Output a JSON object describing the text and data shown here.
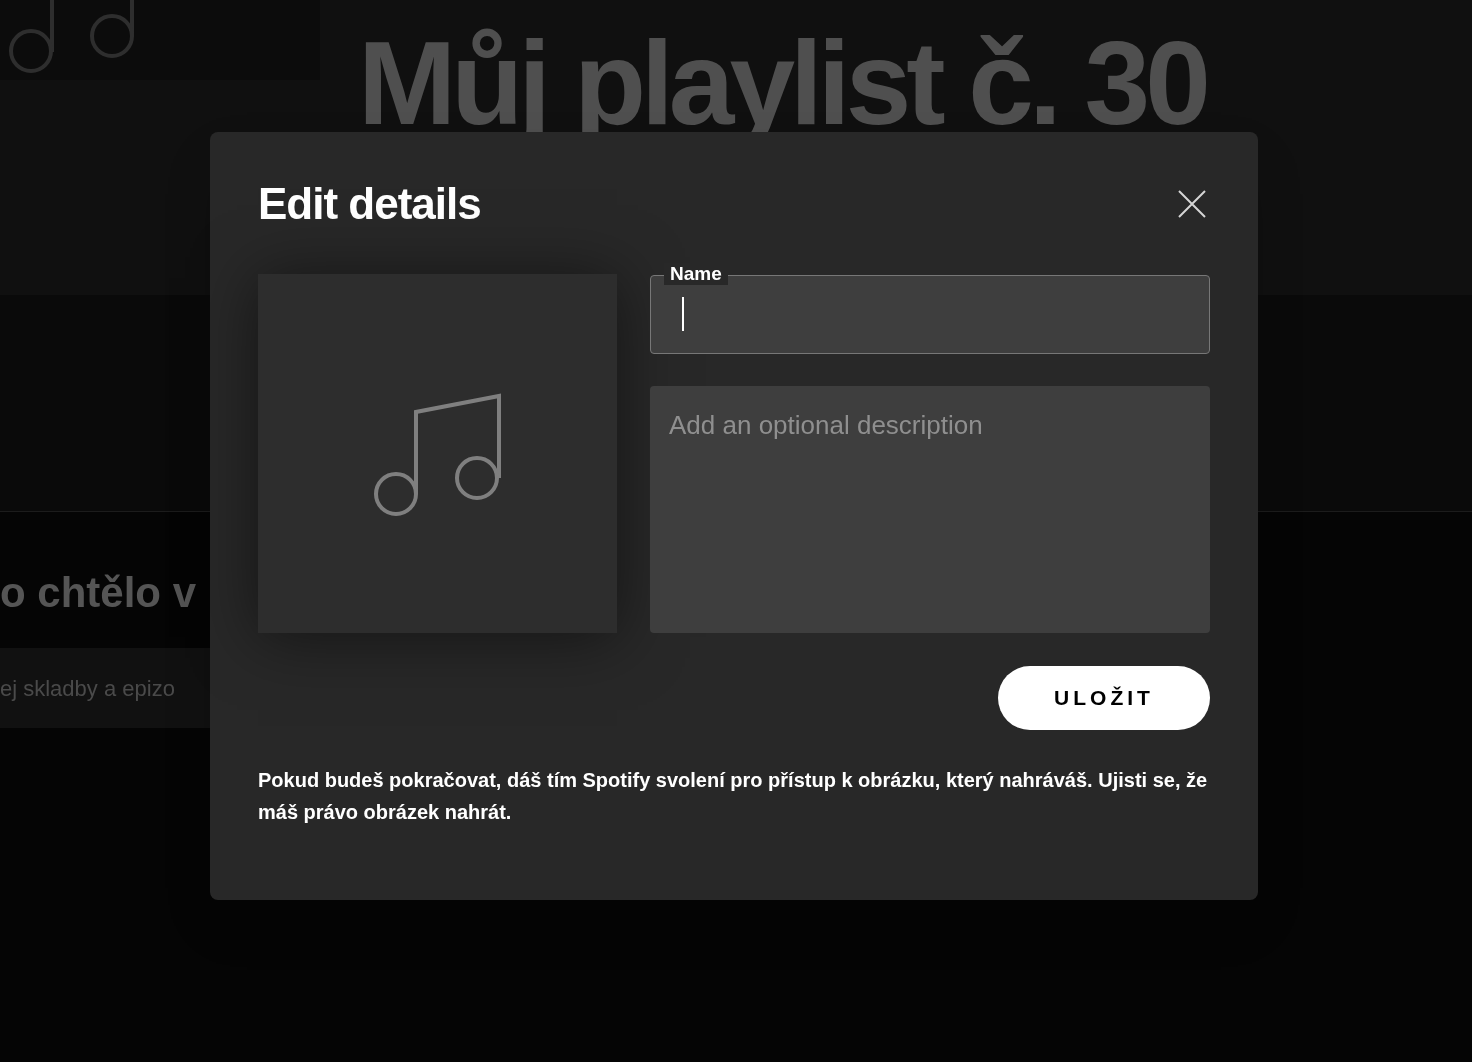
{
  "background": {
    "playlist_title": "Můj playlist č. 30",
    "section_heading": "o chtělo v",
    "search_placeholder": "ej skladby a epizo"
  },
  "dialog": {
    "title": "Edit details",
    "name_field": {
      "label": "Name"
    },
    "description_field": {
      "placeholder": "Add an optional description"
    },
    "save_button": "ULOŽIT",
    "disclaimer": "Pokud budeš pokračovat, dáš tím Spotify svolení pro přístup k obrázku, který nahráváš. Ujisti se, že máš právo obrázek nahrát."
  }
}
